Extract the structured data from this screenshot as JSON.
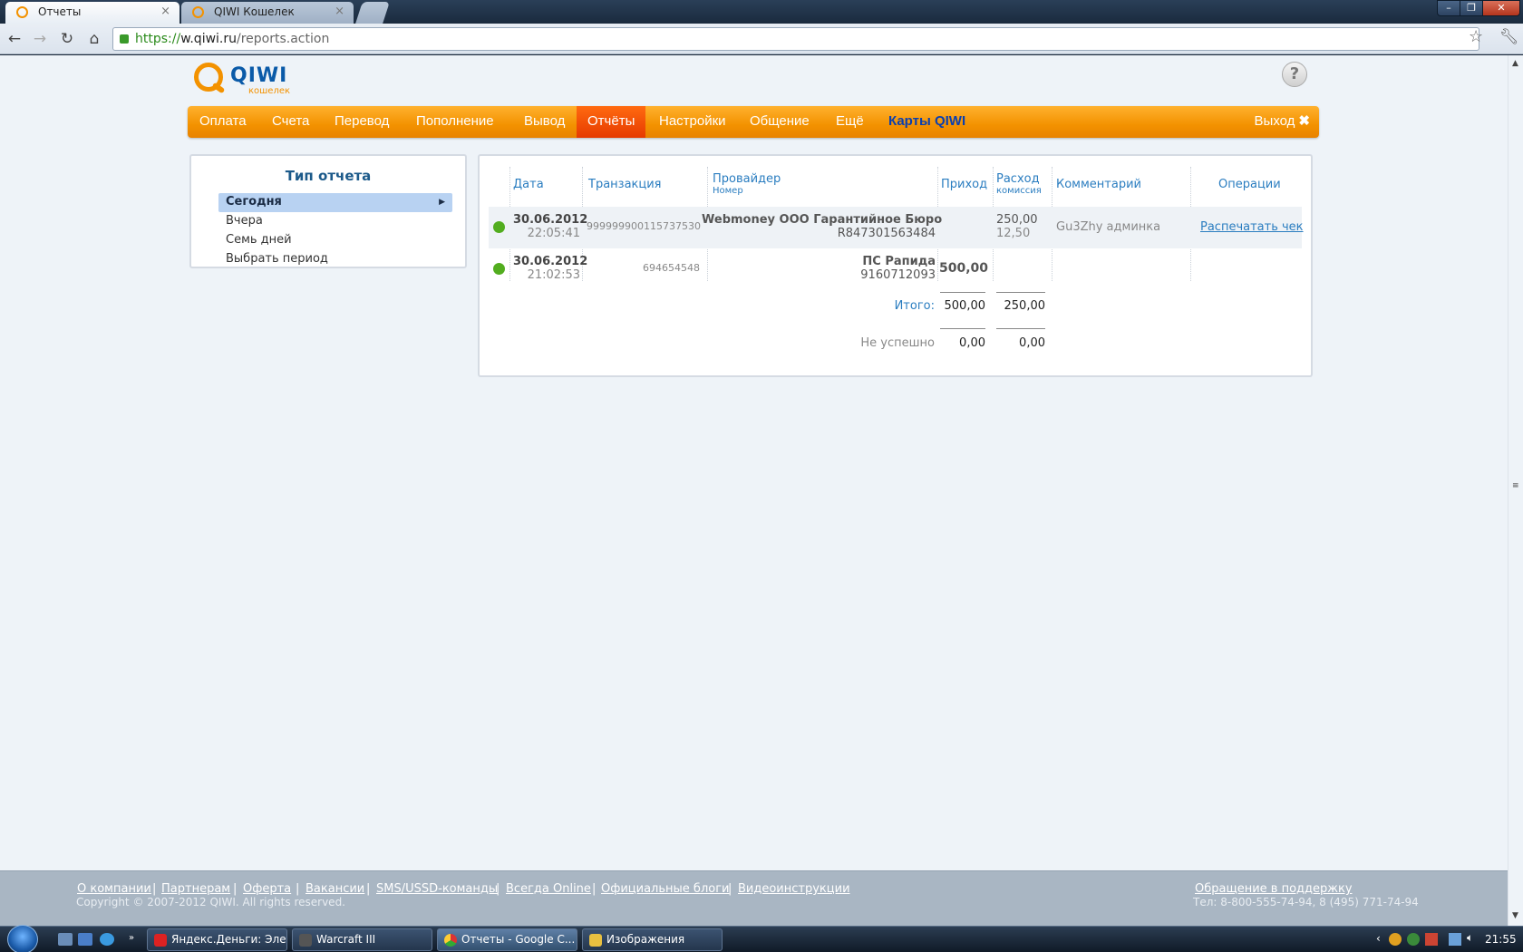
{
  "browser": {
    "tabs": [
      {
        "title": "Отчеты",
        "active": true
      },
      {
        "title": "QIWI Кошелек",
        "active": false
      }
    ],
    "url_scheme": "https://",
    "url_host": "w.qiwi.ru",
    "url_path": "/reports.action"
  },
  "header": {
    "logo_text": "QIWI",
    "logo_sub": "кошелек",
    "help_label": "?"
  },
  "nav": {
    "items": [
      "Оплата",
      "Счета",
      "Перевод",
      "Пополнение",
      "Вывод",
      "Отчёты",
      "Настройки",
      "Общение",
      "Ещё",
      "Карты QIWI"
    ],
    "active": "Отчёты",
    "logout_label": "Выход"
  },
  "report_type": {
    "title": "Тип отчета",
    "items": [
      "Сегодня",
      "Вчера",
      "Семь дней",
      "Выбрать период"
    ],
    "selected": "Сегодня"
  },
  "table": {
    "headers": {
      "date": "Дата",
      "transaction": "Транзакция",
      "provider": "Провайдер",
      "provider_sub": "Номер",
      "income": "Приход",
      "expense": "Расход",
      "expense_sub": "комиссия",
      "comment": "Комментарий",
      "operations": "Операции"
    },
    "rows": [
      {
        "status_color": "#52ad1f",
        "date": "30.06.2012",
        "time": "22:05:41",
        "transaction": "999999900115737530",
        "provider": "Webmoney ООО Гарантийное Бюро",
        "number": "R847301563484",
        "income": "",
        "expense": "250,00",
        "commission": "12,50",
        "comment": "Gu3Zhy админка",
        "operation": "Распечатать чек"
      },
      {
        "status_color": "#52ad1f",
        "date": "30.06.2012",
        "time": "21:02:53",
        "transaction": "694654548",
        "provider": "ПС Рапида",
        "number": "9160712093",
        "income": "500,00",
        "expense": "",
        "commission": "",
        "comment": "",
        "operation": ""
      }
    ],
    "total_label": "Итого:",
    "total_income": "500,00",
    "total_expense": "250,00",
    "failed_label": "Не успешно",
    "failed_income": "0,00",
    "failed_expense": "0,00"
  },
  "footer": {
    "links": [
      "О компании",
      "Партнерам",
      "Оферта",
      "Вакансии",
      "SMS/USSD-команды",
      "Всегда Online",
      "Официальные блоги",
      "Видеоинструкции"
    ],
    "copyright": "Copyright © 2007-2012 QIWI. All rights reserved.",
    "support_link": "Обращение в поддержку",
    "phone": "Тел: 8-800-555-74-94, 8 (495) 771-74-94"
  },
  "taskbar": {
    "tasks": [
      "Яндекс.Деньги: Эле...",
      "Warcraft III",
      "Отчеты - Google C...",
      "Изображения"
    ],
    "clock": "21:55"
  }
}
